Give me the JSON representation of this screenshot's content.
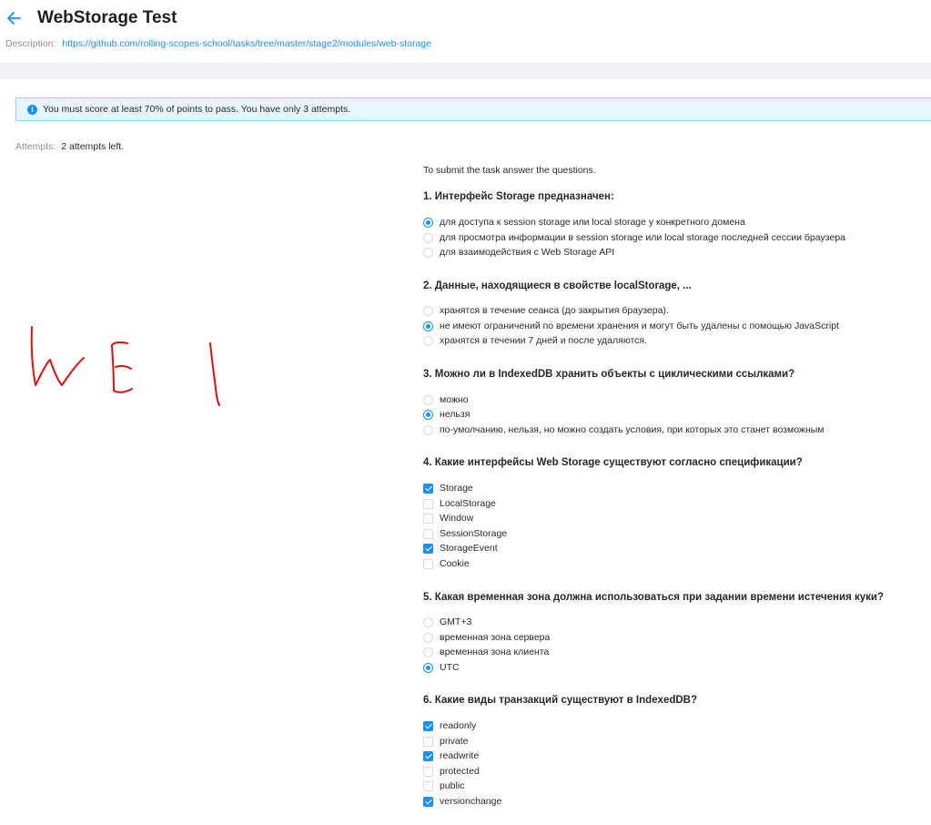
{
  "header": {
    "title": "WebStorage Test",
    "description_label": "Description:",
    "description_link": "https://github.com/rolling-scopes-school/tasks/tree/master/stage2/modules/web-storage"
  },
  "alert": {
    "message": "You must score at least 70% of points to pass. You have only 3 attempts."
  },
  "attempts": {
    "label": "Attempts:",
    "value": "2 attempts left."
  },
  "colors": {
    "accent": "#1890ff",
    "scribble": "#e01010"
  },
  "intro": "To submit the task answer the questions.",
  "questions": [
    {
      "title": "1. Интерфейс Storage предназначен:",
      "type": "radio",
      "options": [
        {
          "label": "для доступа к session storage или local storage у конкретного домена",
          "selected": true
        },
        {
          "label": "для просмотра информации в session storage или local storage последней сессии браузера",
          "selected": false
        },
        {
          "label": "для взаимодействия с Web Storage API",
          "selected": false
        }
      ]
    },
    {
      "title": "2. Данные, находящиеся в свойстве localStorage, ...",
      "type": "radio",
      "options": [
        {
          "label": "хранятся в течение сеанса (до закрытия браузера).",
          "selected": false
        },
        {
          "label": "не имеют ограничений по времени хранения и могут быть удалены с помощью JavaScript",
          "selected": true
        },
        {
          "label": "хранятся в течении 7 дней и после удаляются.",
          "selected": false
        }
      ]
    },
    {
      "title": "3. Можно ли в IndexedDB хранить объекты с циклическими ссылками?",
      "type": "radio",
      "options": [
        {
          "label": "можно",
          "selected": false
        },
        {
          "label": "нельзя",
          "selected": true
        },
        {
          "label": "по-умолчанию, нельзя, но можно создать условия, при которых это станет возможным",
          "selected": false
        }
      ]
    },
    {
      "title": "4. Какие интерфейсы Web Storage существуют согласно спецификации?",
      "type": "checkbox",
      "options": [
        {
          "label": "Storage",
          "selected": true
        },
        {
          "label": "LocalStorage",
          "selected": false
        },
        {
          "label": "Window",
          "selected": false
        },
        {
          "label": "SessionStorage",
          "selected": false
        },
        {
          "label": "StorageEvent",
          "selected": true
        },
        {
          "label": "Cookie",
          "selected": false
        }
      ]
    },
    {
      "title": "5. Какая временная зона должна использоваться при задании времени истечения куки?",
      "type": "radio",
      "options": [
        {
          "label": "GMT+3",
          "selected": false
        },
        {
          "label": "временная зона сервера",
          "selected": false
        },
        {
          "label": "временная зона клиента",
          "selected": false
        },
        {
          "label": "UTC",
          "selected": true
        }
      ]
    },
    {
      "title": "6. Какие виды транзакций существуют в IndexedDB?",
      "type": "checkbox",
      "options": [
        {
          "label": "readonly",
          "selected": true
        },
        {
          "label": "private",
          "selected": false
        },
        {
          "label": "readwrite",
          "selected": true
        },
        {
          "label": "protected",
          "selected": false
        },
        {
          "label": "public",
          "selected": false
        },
        {
          "label": "versionchange",
          "selected": true
        }
      ]
    }
  ]
}
